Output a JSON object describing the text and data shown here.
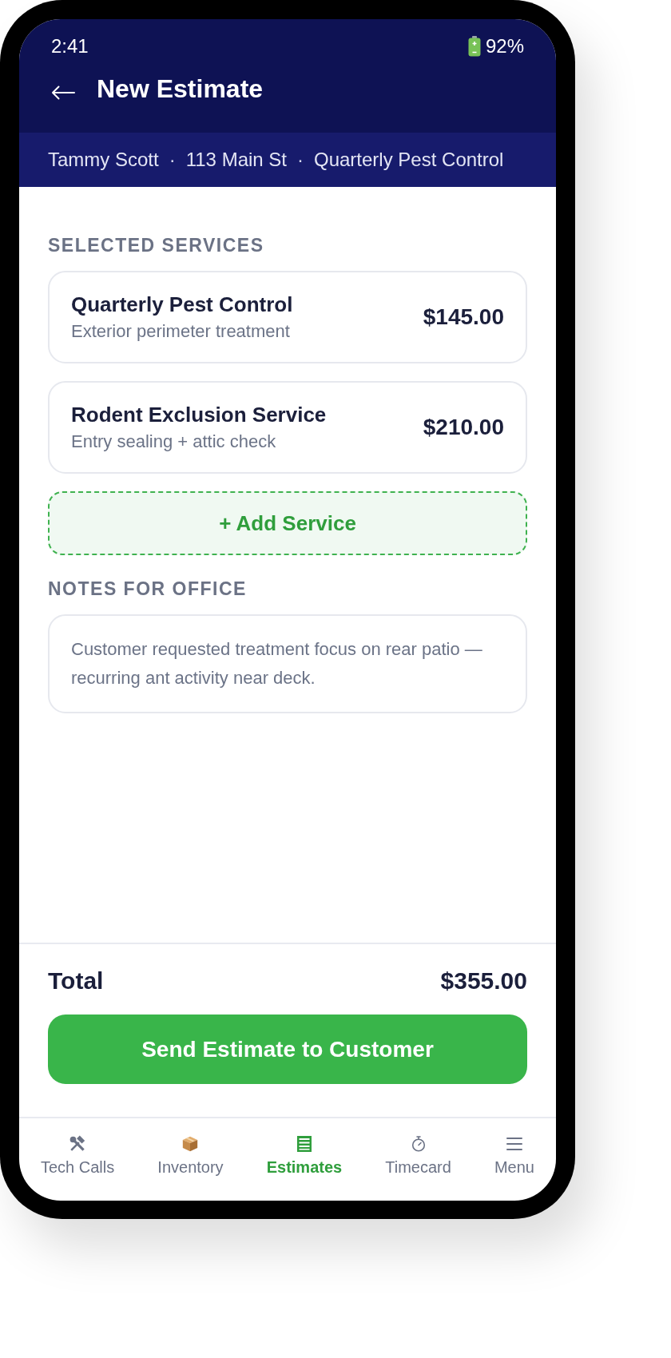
{
  "status_bar": {
    "time": "2:41",
    "battery": "92%"
  },
  "header": {
    "title": "New Estimate"
  },
  "job_context": [
    {
      "kind": "text",
      "text": "Tammy Scott"
    },
    {
      "kind": "separator",
      "text": "·"
    },
    {
      "kind": "text",
      "text": "113 Main St"
    },
    {
      "kind": "separator",
      "text": "·"
    },
    {
      "kind": "text",
      "text": "Quarterly Pest Control"
    }
  ],
  "services_section": {
    "heading": "SELECTED SERVICES",
    "services": [
      {
        "name": "Quarterly Pest Control",
        "description": "Exterior perimeter treatment",
        "price": "$145.00"
      },
      {
        "name": "Rodent Exclusion Service",
        "description": "Entry sealing + attic check",
        "price": "$210.00"
      }
    ],
    "add_button": "+ Add Service"
  },
  "notes_section": {
    "heading": "NOTES FOR OFFICE",
    "value": "Customer requested treatment focus on rear patio — recurring ant activity near deck."
  },
  "total": {
    "label": "Total",
    "amount": "$355.00"
  },
  "send_button": "Send Estimate to Customer",
  "bottom_nav": [
    {
      "label": "Tech Calls",
      "selected": false
    },
    {
      "label": "Inventory",
      "selected": false
    },
    {
      "label": "Estimates",
      "selected": true
    },
    {
      "label": "Timecard",
      "selected": false
    },
    {
      "label": "Menu",
      "selected": false
    }
  ]
}
